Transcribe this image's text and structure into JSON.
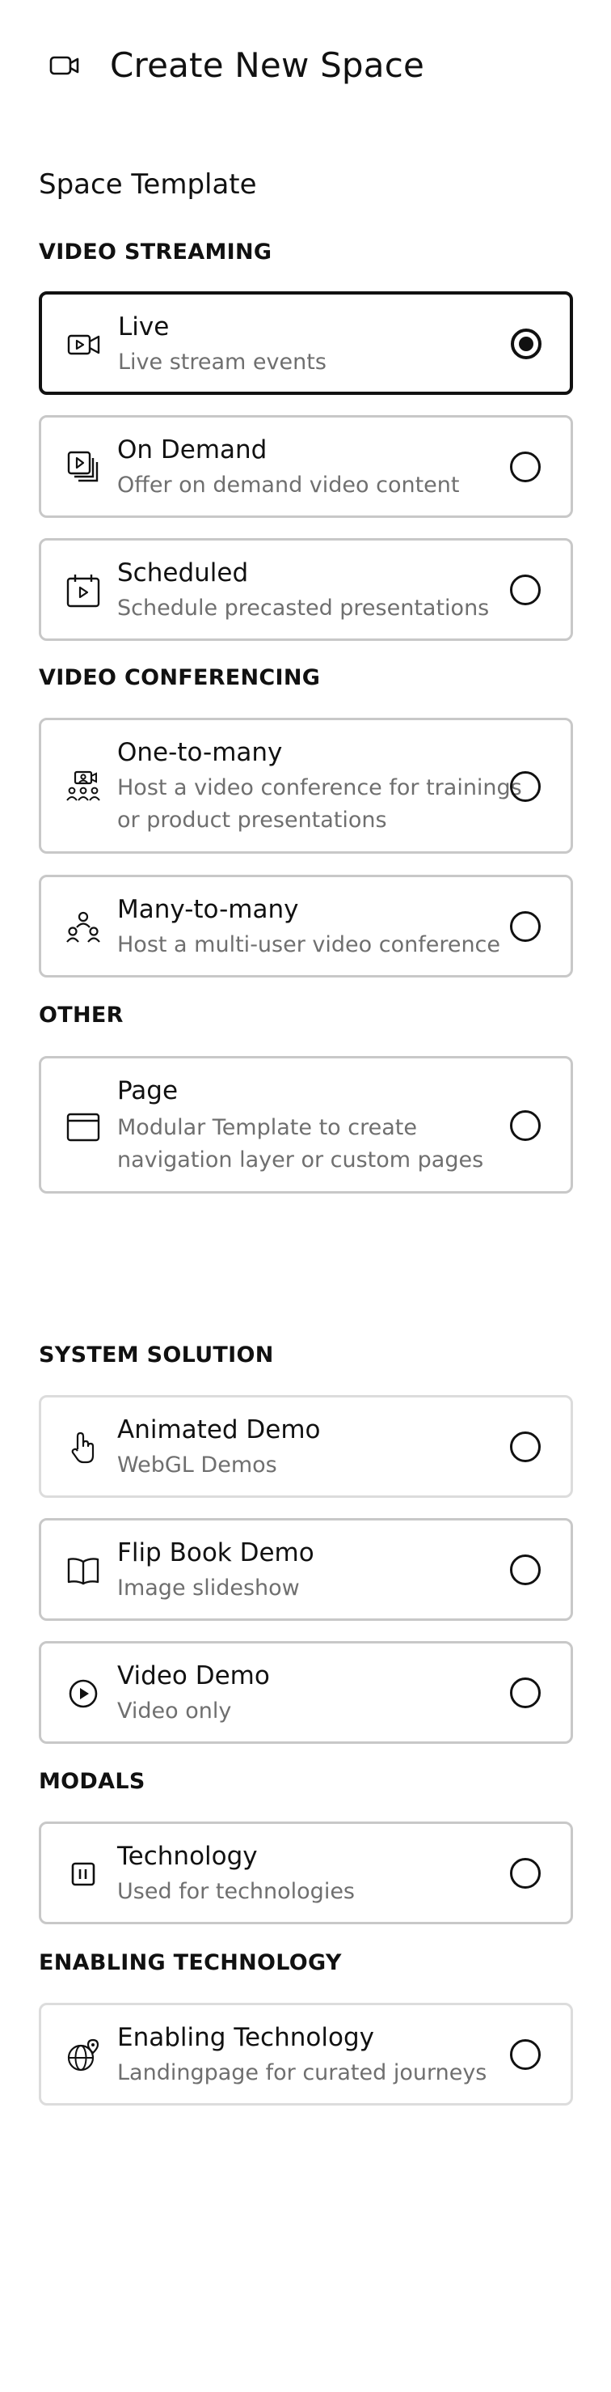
{
  "header": {
    "title": "Create New Space",
    "icon": "video-camera-icon"
  },
  "section_title": "Space Template",
  "groups": {
    "video_streaming": "VIDEO STREAMING",
    "video_conferencing": "VIDEO CONFERENCING",
    "other": "OTHER",
    "system_solution": "SYSTEM SOLUTION",
    "modals": "MODALS",
    "enabling_technology": "ENABLING TECHNOLOGY"
  },
  "templates": {
    "live": {
      "title": "Live",
      "description": "Live stream events",
      "icon": "video-camera-icon",
      "selected": true
    },
    "on_demand": {
      "title": "On Demand",
      "description": "Offer on demand video content",
      "icon": "video-stack-icon",
      "selected": false
    },
    "scheduled": {
      "title": "Scheduled",
      "description": "Schedule precasted presentations",
      "icon": "calendar-play-icon",
      "selected": false
    },
    "one_to_many": {
      "title": "One-to-many",
      "description": "Host a video conference for trainings or product presentations",
      "icon": "presenter-audience-icon",
      "selected": false
    },
    "many_to_many": {
      "title": "Many-to-many",
      "description": "Host a multi-user video conference",
      "icon": "group-icon",
      "selected": false
    },
    "page": {
      "title": "Page",
      "description": "Modular Template to create navigation layer or custom pages",
      "icon": "browser-window-icon",
      "selected": false
    },
    "animated_demo": {
      "title": "Animated Demo",
      "description": "WebGL Demos",
      "icon": "hand-pointer-icon",
      "selected": false
    },
    "flip_book_demo": {
      "title": "Flip Book Demo",
      "description": "Image slideshow",
      "icon": "open-book-icon",
      "selected": false
    },
    "video_demo": {
      "title": "Video Demo",
      "description": "Video only",
      "icon": "play-circle-icon",
      "selected": false
    },
    "technology": {
      "title": "Technology",
      "description": "Used for technologies",
      "icon": "pause-square-icon",
      "selected": false
    },
    "enabling_technology": {
      "title": "Enabling Technology",
      "description": "Landingpage for curated journeys",
      "icon": "globe-pin-icon",
      "selected": false
    }
  },
  "colors": {
    "text": "#111111",
    "muted": "#6f6f6f",
    "border": "#c8c8c8",
    "selected_border": "#111111"
  }
}
